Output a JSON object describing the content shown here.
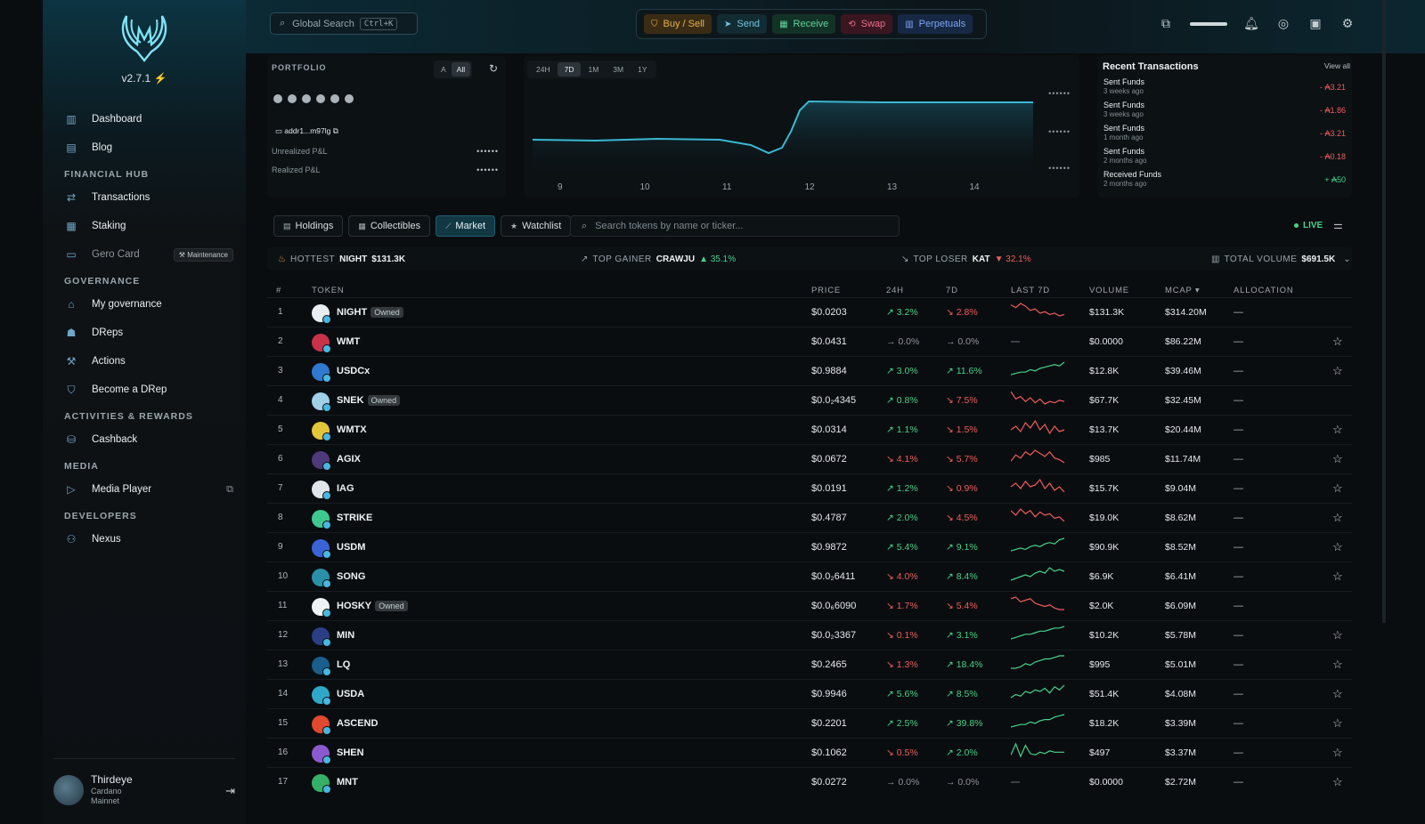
{
  "sidebar": {
    "version": "v2.7.1",
    "items": [
      {
        "type": "item",
        "label": "Dashboard",
        "icon": "dashboard-icon",
        "glyph": "▥"
      },
      {
        "type": "item",
        "label": "Blog",
        "icon": "blog-icon",
        "glyph": "▤"
      },
      {
        "type": "section",
        "label": "FINANCIAL HUB"
      },
      {
        "type": "item",
        "label": "Transactions",
        "icon": "transactions-icon",
        "glyph": "⇄"
      },
      {
        "type": "item",
        "label": "Staking",
        "icon": "staking-icon",
        "glyph": "▦"
      },
      {
        "type": "item",
        "label": "Gero Card",
        "icon": "card-icon",
        "glyph": "▭",
        "muted": true,
        "badge": "Maintenance"
      },
      {
        "type": "section",
        "label": "GOVERNANCE"
      },
      {
        "type": "item",
        "label": "My governance",
        "icon": "governance-icon",
        "glyph": "⌂"
      },
      {
        "type": "item",
        "label": "DReps",
        "icon": "dreps-icon",
        "glyph": "☗"
      },
      {
        "type": "item",
        "label": "Actions",
        "icon": "actions-icon",
        "glyph": "⚒"
      },
      {
        "type": "item",
        "label": "Become a DRep",
        "icon": "become-drep-icon",
        "glyph": "⛉"
      },
      {
        "type": "section",
        "label": "ACTIVITIES & REWARDS"
      },
      {
        "type": "item",
        "label": "Cashback",
        "icon": "cashback-icon",
        "glyph": "⛁"
      },
      {
        "type": "section",
        "label": "MEDIA"
      },
      {
        "type": "item",
        "label": "Media Player",
        "icon": "media-player-icon",
        "glyph": "▷",
        "extra": "⧉"
      },
      {
        "type": "section",
        "label": "DEVELOPERS"
      },
      {
        "type": "item",
        "label": "Nexus",
        "icon": "nexus-icon",
        "glyph": "⚇"
      }
    ],
    "user": {
      "name": "Thirdeye",
      "chain": "Cardano",
      "network": "Mainnet"
    }
  },
  "header": {
    "search_placeholder": "Global Search",
    "search_shortcut": "Ctrl+K",
    "actions": [
      {
        "label": "Buy / Sell",
        "cls": "a-buy",
        "glyph": "⛉",
        "icon": "buy-sell-icon"
      },
      {
        "label": "Send",
        "cls": "a-send",
        "glyph": "➤",
        "icon": "send-icon"
      },
      {
        "label": "Receive",
        "cls": "a-recv",
        "glyph": "▦",
        "icon": "receive-icon"
      },
      {
        "label": "Swap",
        "cls": "a-swap",
        "glyph": "⟲",
        "icon": "swap-icon"
      },
      {
        "label": "Perpetuals",
        "cls": "a-perp",
        "glyph": "▥",
        "icon": "perpetuals-icon"
      }
    ]
  },
  "portfolio": {
    "label": "PORTFOLIO",
    "seg": [
      "A",
      "All"
    ],
    "address": "addr1...m97lg",
    "unrealized_label": "Unrealized P&L",
    "realized_label": "Realized P&L",
    "hidden_value": "••••••"
  },
  "chart": {
    "timeframes": [
      "24H",
      "7D",
      "1M",
      "3M",
      "1Y"
    ],
    "active_tf": "7D",
    "x_ticks": [
      "9",
      "10",
      "11",
      "12",
      "13",
      "14"
    ],
    "hidden_value": "••••••"
  },
  "recent": {
    "title": "Recent Transactions",
    "view_all": "View all",
    "items": [
      {
        "type": "Sent Funds",
        "time": "3 weeks ago",
        "amount": "- ₳3.21",
        "positive": false
      },
      {
        "type": "Sent Funds",
        "time": "3 weeks ago",
        "amount": "- ₳1.86",
        "positive": false
      },
      {
        "type": "Sent Funds",
        "time": "1 month ago",
        "amount": "- ₳3.21",
        "positive": false
      },
      {
        "type": "Sent Funds",
        "time": "2 months ago",
        "amount": "- ₳0.18",
        "positive": false
      },
      {
        "type": "Received Funds",
        "time": "2 months ago",
        "amount": "+ ₳50",
        "positive": true
      }
    ]
  },
  "tabs": [
    {
      "label": "Holdings",
      "glyph": "▤",
      "active": false
    },
    {
      "label": "Collectibles",
      "glyph": "▦",
      "active": false
    },
    {
      "label": "Market",
      "glyph": "⟋",
      "active": true
    },
    {
      "label": "Watchlist",
      "glyph": "★",
      "active": false
    }
  ],
  "token_search_placeholder": "Search tokens by name or ticker...",
  "live_label": "LIVE",
  "stats": {
    "hottest_label": "HOTTEST",
    "hottest_token": "NIGHT",
    "hottest_value": "$131.3K",
    "gainer_label": "TOP GAINER",
    "gainer_token": "CRAWJU",
    "gainer_value": "▲ 35.1%",
    "loser_label": "TOP LOSER",
    "loser_token": "KAT",
    "loser_value": "▼ 32.1%",
    "volume_label": "TOTAL VOLUME",
    "volume_value": "$691.5K"
  },
  "columns": {
    "num": "#",
    "token": "TOKEN",
    "price": "PRICE",
    "h24": "24H",
    "d7": "7D",
    "last7d": "LAST 7D",
    "volume": "VOLUME",
    "mcap": "MCAP ▾",
    "allocation": "ALLOCATION"
  },
  "colors": {
    "up": "#47d18b",
    "down": "#ef5d5d",
    "accent": "#123844"
  },
  "rows": [
    {
      "n": "1",
      "t": "NIGHT",
      "owned": true,
      "price": "$0.0203",
      "c24": "3.2%",
      "d24": "up",
      "c7": "2.8%",
      "d7": "down",
      "vol": "$131.3K",
      "mcap": "$314.20M",
      "alloc": "—",
      "star": false,
      "color": "#e8eef1",
      "spark": [
        6,
        8,
        5,
        7,
        10,
        9,
        12,
        11,
        13,
        12,
        14,
        13
      ]
    },
    {
      "n": "2",
      "t": "WMT",
      "owned": false,
      "price": "$0.0431",
      "c24": "0.0%",
      "d24": "flat",
      "c7": "0.0%",
      "d7": "flat",
      "vol": "$0.0000",
      "mcap": "$86.22M",
      "alloc": "—",
      "star": true,
      "color": "#c8334a",
      "spark": null
    },
    {
      "n": "3",
      "t": "USDCx",
      "owned": false,
      "price": "$0.9884",
      "c24": "3.0%",
      "d24": "up",
      "c7": "11.6%",
      "d7": "up",
      "vol": "$12.8K",
      "mcap": "$39.46M",
      "alloc": "—",
      "star": true,
      "color": "#2f7ad0",
      "spark": [
        14,
        13,
        12,
        12,
        10,
        11,
        9,
        8,
        7,
        6,
        7,
        4
      ]
    },
    {
      "n": "4",
      "t": "SNEK",
      "owned": true,
      "price": "$0.0₂4345",
      "c24": "0.8%",
      "d24": "up",
      "c7": "7.5%",
      "d7": "down",
      "vol": "$67.7K",
      "mcap": "$32.45M",
      "alloc": "—",
      "star": false,
      "color": "#9fd0e8",
      "spark": [
        4,
        10,
        8,
        12,
        9,
        13,
        10,
        14,
        12,
        13,
        11,
        12
      ]
    },
    {
      "n": "5",
      "t": "WMTX",
      "owned": false,
      "price": "$0.0314",
      "c24": "1.1%",
      "d24": "up",
      "c7": "1.5%",
      "d7": "down",
      "vol": "$13.7K",
      "mcap": "$20.44M",
      "alloc": "—",
      "star": true,
      "color": "#e3c53a",
      "spark": [
        10,
        8,
        11,
        6,
        9,
        5,
        10,
        7,
        12,
        8,
        11,
        10
      ]
    },
    {
      "n": "6",
      "t": "AGIX",
      "owned": false,
      "price": "$0.0672",
      "c24": "4.1%",
      "d24": "down",
      "c7": "5.7%",
      "d7": "down",
      "vol": "$985",
      "mcap": "$11.74M",
      "alloc": "—",
      "star": true,
      "color": "#4c3a7a",
      "spark": [
        12,
        8,
        10,
        6,
        8,
        5,
        7,
        9,
        6,
        10,
        11,
        13
      ]
    },
    {
      "n": "7",
      "t": "IAG",
      "owned": false,
      "price": "$0.0191",
      "c24": "1.2%",
      "d24": "up",
      "c7": "0.9%",
      "d7": "down",
      "vol": "$15.7K",
      "mcap": "$9.04M",
      "alloc": "—",
      "star": true,
      "color": "#dfe5e8",
      "spark": [
        9,
        7,
        10,
        6,
        9,
        8,
        5,
        10,
        7,
        11,
        9,
        12
      ]
    },
    {
      "n": "8",
      "t": "STRIKE",
      "owned": false,
      "price": "$0.4787",
      "c24": "2.0%",
      "d24": "up",
      "c7": "4.5%",
      "d7": "down",
      "vol": "$19.0K",
      "mcap": "$8.62M",
      "alloc": "—",
      "star": true,
      "color": "#3ec890",
      "spark": [
        6,
        9,
        5,
        8,
        6,
        10,
        7,
        9,
        8,
        11,
        10,
        13
      ]
    },
    {
      "n": "9",
      "t": "USDM",
      "owned": false,
      "price": "$0.9872",
      "c24": "5.4%",
      "d24": "up",
      "c7": "9.1%",
      "d7": "up",
      "vol": "$90.9K",
      "mcap": "$8.52M",
      "alloc": "—",
      "star": true,
      "color": "#3a63d6",
      "spark": [
        13,
        12,
        11,
        12,
        10,
        9,
        10,
        8,
        7,
        8,
        5,
        4
      ]
    },
    {
      "n": "10",
      "t": "SONG",
      "owned": false,
      "price": "$0.0₂6411",
      "c24": "4.0%",
      "d24": "down",
      "c7": "8.4%",
      "d7": "up",
      "vol": "$6.9K",
      "mcap": "$6.41M",
      "alloc": "—",
      "star": true,
      "color": "#2a8fa8",
      "spark": [
        13,
        12,
        11,
        10,
        11,
        9,
        8,
        9,
        6,
        8,
        7,
        8
      ]
    },
    {
      "n": "11",
      "t": "HOSKY",
      "owned": true,
      "price": "$0.0₆6090",
      "c24": "1.7%",
      "d24": "down",
      "c7": "5.4%",
      "d7": "down",
      "vol": "$2.0K",
      "mcap": "$6.09M",
      "alloc": "—",
      "star": false,
      "color": "#eef2f4",
      "spark": [
        6,
        5,
        8,
        7,
        6,
        9,
        10,
        11,
        10,
        12,
        13,
        13
      ]
    },
    {
      "n": "12",
      "t": "MIN",
      "owned": false,
      "price": "$0.0₂3367",
      "c24": "0.1%",
      "d24": "down",
      "c7": "3.1%",
      "d7": "up",
      "vol": "$10.2K",
      "mcap": "$5.78M",
      "alloc": "—",
      "star": true,
      "color": "#2b3e86",
      "spark": [
        13,
        12,
        11,
        10,
        10,
        9,
        8,
        8,
        7,
        6,
        6,
        5
      ]
    },
    {
      "n": "13",
      "t": "LQ",
      "owned": false,
      "price": "$0.2465",
      "c24": "1.3%",
      "d24": "down",
      "c7": "18.4%",
      "d7": "up",
      "vol": "$995",
      "mcap": "$5.01M",
      "alloc": "—",
      "star": true,
      "color": "#1b5d8c",
      "spark": [
        13,
        13,
        12,
        10,
        11,
        9,
        8,
        7,
        7,
        6,
        5,
        5
      ]
    },
    {
      "n": "14",
      "t": "USDA",
      "owned": false,
      "price": "$0.9946",
      "c24": "5.6%",
      "d24": "up",
      "c7": "8.5%",
      "d7": "up",
      "vol": "$51.4K",
      "mcap": "$4.08M",
      "alloc": "—",
      "star": true,
      "color": "#2fa8c8",
      "spark": [
        12,
        10,
        11,
        8,
        9,
        7,
        8,
        6,
        9,
        5,
        7,
        4
      ]
    },
    {
      "n": "15",
      "t": "ASCEND",
      "owned": false,
      "price": "$0.2201",
      "c24": "2.5%",
      "d24": "up",
      "c7": "39.8%",
      "d7": "up",
      "vol": "$18.2K",
      "mcap": "$3.39M",
      "alloc": "—",
      "star": true,
      "color": "#e0482f",
      "spark": [
        14,
        13,
        12,
        12,
        10,
        11,
        9,
        8,
        8,
        6,
        5,
        4
      ]
    },
    {
      "n": "16",
      "t": "SHEN",
      "owned": false,
      "price": "$0.1062",
      "c24": "0.5%",
      "d24": "down",
      "c7": "2.0%",
      "d7": "up",
      "vol": "$497",
      "mcap": "$3.37M",
      "alloc": "—",
      "star": true,
      "color": "#8c5ad0",
      "spark": [
        12,
        4,
        13,
        5,
        11,
        12,
        10,
        11,
        9,
        10,
        10,
        10
      ]
    },
    {
      "n": "17",
      "t": "MNT",
      "owned": false,
      "price": "$0.0272",
      "c24": "0.0%",
      "d24": "flat",
      "c7": "0.0%",
      "d7": "flat",
      "vol": "$0.0000",
      "mcap": "$2.72M",
      "alloc": "—",
      "star": true,
      "color": "#35b068",
      "spark": null
    }
  ]
}
